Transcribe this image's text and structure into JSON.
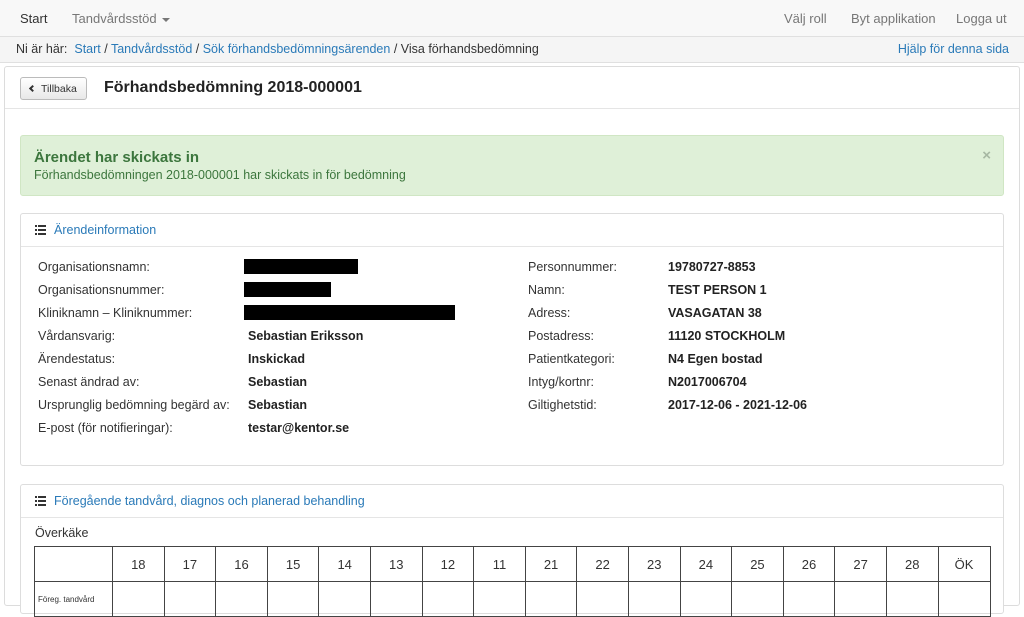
{
  "navbar": {
    "start": "Start",
    "tandvardsstod": "Tandvårdsstöd",
    "valj_roll": "Välj roll",
    "byt_applikation": "Byt applikation",
    "logga_ut": "Logga ut"
  },
  "breadcrumb": {
    "prefix": "Ni är här:",
    "items": [
      "Start",
      "Tandvårdsstöd",
      "Sök förhandsbedömningsärenden",
      "Visa förhandsbedömning"
    ],
    "separator": " / ",
    "help": "Hjälp för denna sida"
  },
  "header": {
    "back_label": "Tillbaka",
    "title": "Förhandsbedömning 2018-000001"
  },
  "alert": {
    "title": "Ärendet har skickats in",
    "message": "Förhandsbedömningen 2018-000001 har skickats in för bedömning",
    "close": "×"
  },
  "arendeinfo": {
    "title": "Ärendeinformation",
    "left": [
      {
        "label": "Organisationsnamn:",
        "value": ""
      },
      {
        "label": "Organisationsnummer:",
        "value": ""
      },
      {
        "label": "Kliniknamn – Kliniknummer:",
        "value": ""
      },
      {
        "label": "Vårdansvarig:",
        "value": "Sebastian Eriksson"
      },
      {
        "label": "Ärendestatus:",
        "value": "Inskickad"
      },
      {
        "label": "Senast ändrad av:",
        "value": "Sebastian"
      },
      {
        "label": "Ursprunglig bedömning begärd av:",
        "value": "Sebastian"
      },
      {
        "label": "E-post (för notifieringar):",
        "value": "testar@kentor.se"
      }
    ],
    "right": [
      {
        "label": "Personnummer:",
        "value": "19780727-8853"
      },
      {
        "label": "Namn:",
        "value": "TEST PERSON 1"
      },
      {
        "label": "Adress:",
        "value": "VASAGATAN 38"
      },
      {
        "label": "Postadress:",
        "value": "11120 STOCKHOLM"
      },
      {
        "label": "Patientkategori:",
        "value": "N4 Egen bostad"
      },
      {
        "label": "Intyg/kortnr:",
        "value": "N2017006704"
      },
      {
        "label": "Giltighetstid:",
        "value": "2017-12-06 - 2021-12-06"
      }
    ]
  },
  "behandling": {
    "title": "Föregående tandvård, diagnos och planerad behandling",
    "jaw_label": "Överkäke",
    "teeth": [
      "18",
      "17",
      "16",
      "15",
      "14",
      "13",
      "12",
      "11",
      "21",
      "22",
      "23",
      "24",
      "25",
      "26",
      "27",
      "28",
      "ÖK"
    ],
    "row_label": "Föreg. tandvård"
  }
}
